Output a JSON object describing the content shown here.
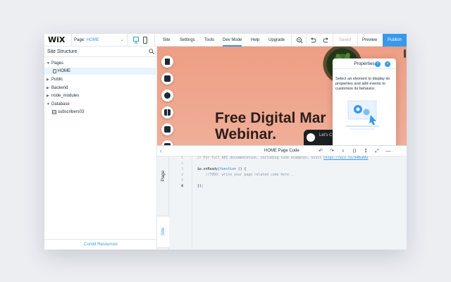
{
  "topbar": {
    "logo": "WiX",
    "page_label": "Page:",
    "page_value": "HOME",
    "menu": [
      "Site",
      "Settings",
      "Tools",
      "Dev Mode",
      "Help",
      "Upgrade"
    ],
    "active_menu": "Dev Mode",
    "saved": "Saved",
    "preview": "Preview",
    "publish": "Publish"
  },
  "sidebar": {
    "title": "Site Structure",
    "tree": [
      {
        "label": "Pages",
        "expanded": true
      },
      {
        "label": "HOME",
        "child": true,
        "selected": true
      },
      {
        "label": "Public",
        "expanded": false
      },
      {
        "label": "Backend",
        "expanded": false
      },
      {
        "label": "node_modules",
        "expanded": false
      },
      {
        "label": "Database",
        "expanded": true
      },
      {
        "label": "subscribers03",
        "child": true
      }
    ],
    "footer": "Corvid Resources"
  },
  "stage": {
    "hero_title": "Free Digital Mar\nWebinar.",
    "chat_text": "Let's C"
  },
  "properties": {
    "title": "Properties",
    "help": "?",
    "close": "×",
    "description": "Select an element to display its properties and add events to customize its behavior."
  },
  "code_panel": {
    "title": "HOME Page Code",
    "tab_page": "Page",
    "tab_site": "Site",
    "line_numbers": [
      "1",
      "2",
      "3",
      "4",
      "5",
      "6"
    ],
    "current_line": "6",
    "lines": {
      "l1_comment": "// For full API documentation, including code examples, visit ",
      "l1_link": "https://wix.to/94BuAAs",
      "l3_a": "$w.onReady(",
      "l3_kw": "function",
      "l3_b": " () {",
      "l4": "    //TODO: write your page related code here...",
      "l6": "});"
    }
  },
  "colors": {
    "accent": "#3899ec",
    "stage_bg": "#eea38a",
    "panel_bg": "#f1f4f7"
  }
}
